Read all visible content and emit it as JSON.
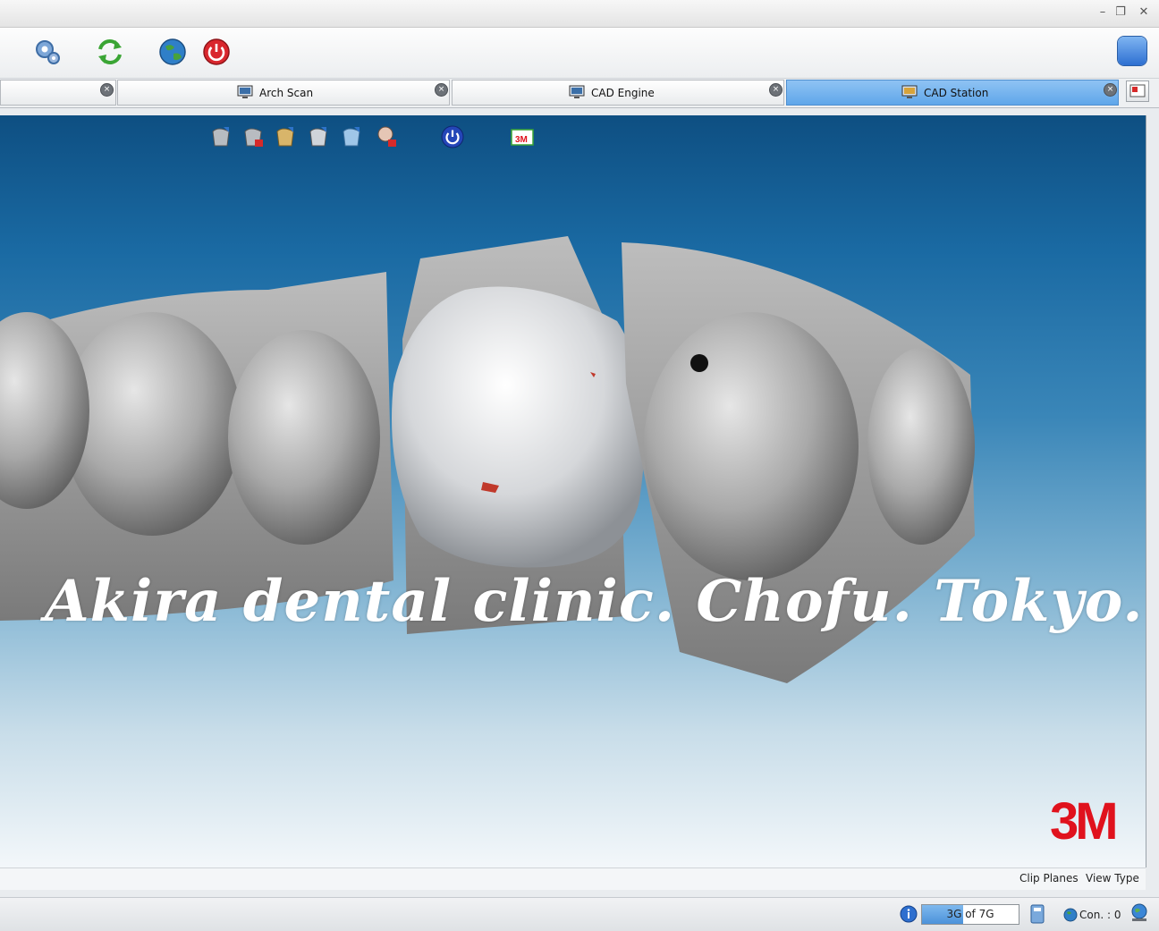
{
  "window": {
    "controls": {
      "minimize": "–",
      "restore": "❐",
      "close": "✕"
    }
  },
  "toolbar": {
    "icons": [
      "gear-icon",
      "refresh-icon",
      "globe-icon",
      "power-icon"
    ]
  },
  "tabs": [
    {
      "label": "",
      "active": false
    },
    {
      "label": "Arch Scan",
      "active": false
    },
    {
      "label": "CAD Engine",
      "active": false
    },
    {
      "label": "CAD Station",
      "active": true
    }
  ],
  "viewport": {
    "watermark": "Akira dental clinic. Chofu. Tokyo.",
    "logo": "3M",
    "tool_icons": [
      "tooth-upload-icon",
      "tooth-delete-icon",
      "tooth-gold-icon",
      "tooth-copy-icon",
      "tooth-clip-icon",
      "tooth-person-delete-icon",
      "power-icon",
      "3m-window-icon"
    ]
  },
  "bottombar": {
    "clip_planes": "Clip Planes",
    "view_type": "View Type"
  },
  "status": {
    "progress_text": "3G of 7G",
    "progress": 0.43,
    "connection": "Con. : 0"
  },
  "colors": {
    "accent": "#5fa6ea",
    "brand_3m": "#e0121d",
    "viewport_top": "#0e4f82"
  }
}
